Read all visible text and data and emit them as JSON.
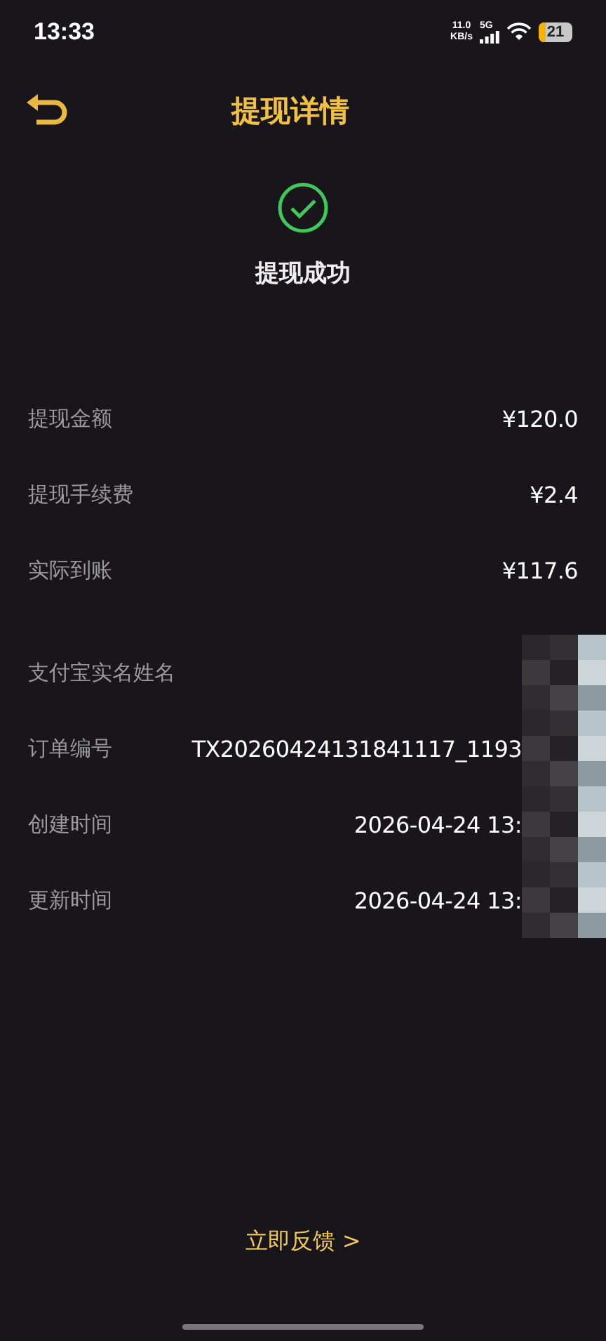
{
  "status_bar": {
    "time": "13:33",
    "net_speed": "11.0",
    "net_unit": "KB/s",
    "network": "5G",
    "battery": "21"
  },
  "header": {
    "title": "提现详情"
  },
  "result": {
    "status": "提现成功",
    "success": true
  },
  "amounts": [
    {
      "label": "提现金额",
      "value": "¥120.0",
      "redacted": false
    },
    {
      "label": "提现手续费",
      "value": "¥2.4",
      "redacted": false
    },
    {
      "label": "实际到账",
      "value": "¥117.6",
      "redacted": false
    }
  ],
  "details": [
    {
      "label": "支付宝实名姓名",
      "redacted": true
    },
    {
      "label": "订单编号",
      "value": "TX20260424131841117_1193",
      "redacted": true
    },
    {
      "label": "创建时间",
      "value": "2026-04-24 13:",
      "redacted": true
    },
    {
      "label": "更新时间",
      "value": "2026-04-24 13:",
      "redacted": true
    }
  ],
  "feedback_link": {
    "label": "立即反馈 >"
  }
}
